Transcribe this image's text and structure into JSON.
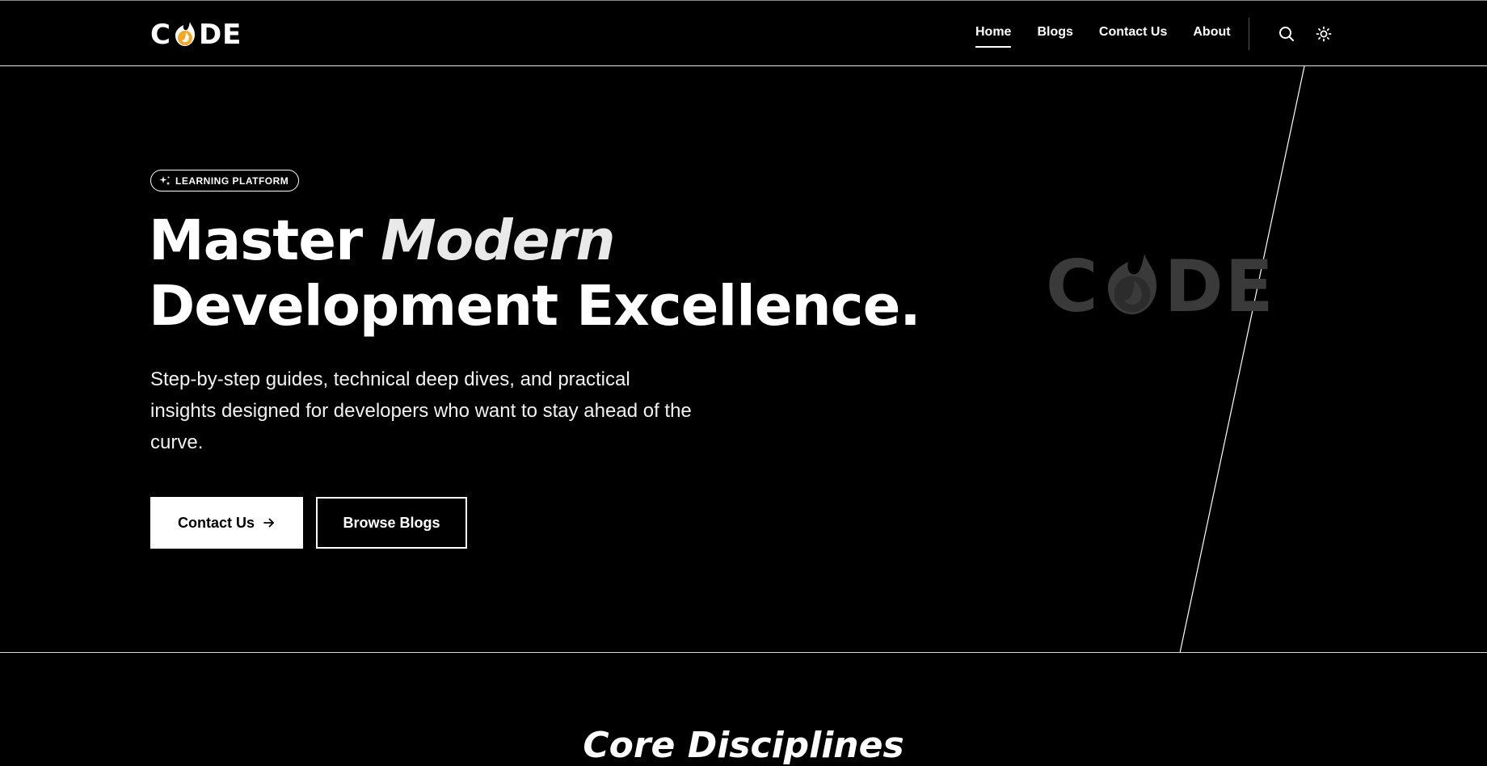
{
  "brand": {
    "logo_prefix": "C",
    "logo_suffix": "DE",
    "accent_color": "#f5a623"
  },
  "nav": {
    "items": [
      {
        "label": "Home",
        "active": true
      },
      {
        "label": "Blogs",
        "active": false
      },
      {
        "label": "Contact Us",
        "active": false
      },
      {
        "label": "About",
        "active": false
      }
    ],
    "icons": [
      "search-icon",
      "sun-icon"
    ]
  },
  "hero": {
    "badge": "LEARNING PLATFORM",
    "headline_part1": "Master ",
    "headline_emphasis": "Modern",
    "headline_line2": "Development Excellence.",
    "subtext": "Step-by-step guides, technical deep dives, and practical insights designed for developers who want to stay ahead of the curve.",
    "primary_button": "Contact Us",
    "secondary_button": "Browse Blogs"
  },
  "section": {
    "title": "Core Disciplines"
  }
}
